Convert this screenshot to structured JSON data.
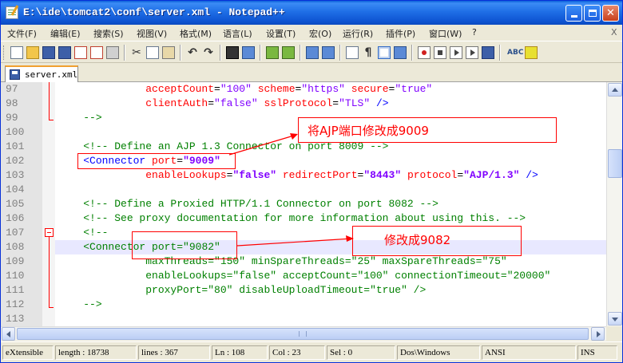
{
  "window": {
    "title": "E:\\ide\\tomcat2\\conf\\server.xml - Notepad++"
  },
  "menu": {
    "items": [
      "文件(F)",
      "编辑(E)",
      "搜索(S)",
      "视图(V)",
      "格式(M)",
      "语言(L)",
      "设置(T)",
      "宏(O)",
      "运行(R)",
      "插件(P)",
      "窗口(W)",
      "?"
    ],
    "close_glyph": "X"
  },
  "toolbar": {
    "icons": [
      "new-file-icon",
      "open-file-icon",
      "save-icon",
      "save-all-icon",
      "close-icon",
      "close-all-icon",
      "print-icon",
      "cut-icon",
      "copy-icon",
      "paste-icon",
      "undo-icon",
      "redo-icon",
      "find-icon",
      "replace-icon",
      "zoom-in-icon",
      "zoom-out-icon",
      "sync-v-icon",
      "sync-h-icon",
      "word-wrap-icon",
      "show-all-chars-icon",
      "indent-guide-icon",
      "user-lang-icon",
      "record-macro-icon",
      "stop-macro-icon",
      "play-macro-icon",
      "run-macro-multiple-icon",
      "save-macro-icon",
      "spell-check-icon",
      "doc-map-icon"
    ]
  },
  "tab": {
    "label": "server.xml"
  },
  "editor": {
    "current_line": "108",
    "lines": [
      {
        "n": "97",
        "indent": "              ",
        "tokens": [
          [
            "attr",
            "acceptCount"
          ],
          [
            "eq",
            "="
          ],
          [
            "val",
            "\"100\""
          ],
          [
            "eq",
            " "
          ],
          [
            "attr",
            "scheme"
          ],
          [
            "eq",
            "="
          ],
          [
            "val",
            "\"https\""
          ],
          [
            "eq",
            " "
          ],
          [
            "attr",
            "secure"
          ],
          [
            "eq",
            "="
          ],
          [
            "val",
            "\"true\""
          ]
        ]
      },
      {
        "n": "98",
        "indent": "              ",
        "tokens": [
          [
            "attr",
            "clientAuth"
          ],
          [
            "eq",
            "="
          ],
          [
            "val",
            "\"false\""
          ],
          [
            "eq",
            " "
          ],
          [
            "attr",
            "sslProtocol"
          ],
          [
            "eq",
            "="
          ],
          [
            "val",
            "\"TLS\""
          ],
          [
            "eq",
            " "
          ],
          [
            "tag",
            "/>"
          ]
        ]
      },
      {
        "n": "99",
        "indent": "    ",
        "tokens": [
          [
            "cmt",
            "-->"
          ]
        ]
      },
      {
        "n": "100",
        "indent": "",
        "tokens": []
      },
      {
        "n": "101",
        "indent": "    ",
        "tokens": [
          [
            "cmt",
            "<!-- Define an AJP 1.3 Connector on port 8009 -->"
          ]
        ]
      },
      {
        "n": "102",
        "indent": "    ",
        "tokens": [
          [
            "tag",
            "<Connector"
          ],
          [
            "eq",
            " "
          ],
          [
            "attr",
            "port"
          ],
          [
            "eq",
            "="
          ],
          [
            "valb",
            "\"9009\""
          ]
        ]
      },
      {
        "n": "103",
        "indent": "              ",
        "tokens": [
          [
            "attr",
            "enableLookups"
          ],
          [
            "eq",
            "="
          ],
          [
            "valb",
            "\"false\""
          ],
          [
            "eq",
            " "
          ],
          [
            "attr",
            "redirectPort"
          ],
          [
            "eq",
            "="
          ],
          [
            "valb",
            "\"8443\""
          ],
          [
            "eq",
            " "
          ],
          [
            "attr",
            "protocol"
          ],
          [
            "eq",
            "="
          ],
          [
            "valb",
            "\"AJP/1.3\""
          ],
          [
            "eq",
            " "
          ],
          [
            "tag",
            "/>"
          ]
        ]
      },
      {
        "n": "104",
        "indent": "",
        "tokens": []
      },
      {
        "n": "105",
        "indent": "    ",
        "tokens": [
          [
            "cmt",
            "<!-- Define a Proxied HTTP/1.1 Connector on port 8082 -->"
          ]
        ]
      },
      {
        "n": "106",
        "indent": "    ",
        "tokens": [
          [
            "cmt",
            "<!-- See proxy documentation for more information about using this. -->"
          ]
        ]
      },
      {
        "n": "107",
        "indent": "    ",
        "tokens": [
          [
            "cmt",
            "<!--"
          ]
        ]
      },
      {
        "n": "108",
        "indent": "    ",
        "tokens": [
          [
            "cmt",
            "<Connector port=\"9082\""
          ]
        ]
      },
      {
        "n": "109",
        "indent": "              ",
        "tokens": [
          [
            "cmt",
            "maxThreads=\"150\" minSpareThreads=\"25\" maxSpareThreads=\"75\""
          ]
        ]
      },
      {
        "n": "110",
        "indent": "              ",
        "tokens": [
          [
            "cmt",
            "enableLookups=\"false\" acceptCount=\"100\" connectionTimeout=\"20000\""
          ]
        ]
      },
      {
        "n": "111",
        "indent": "              ",
        "tokens": [
          [
            "cmt",
            "proxyPort=\"80\" disableUploadTimeout=\"true\" />"
          ]
        ]
      },
      {
        "n": "112",
        "indent": "    ",
        "tokens": [
          [
            "cmt",
            "-->"
          ]
        ]
      },
      {
        "n": "113",
        "indent": "",
        "tokens": []
      }
    ]
  },
  "annotations": {
    "ajp_note": "将AJP端口修改成9009",
    "proxy_note": "修改成9082",
    "color": "#ff0000"
  },
  "status": {
    "file_type": "eXtensible",
    "length": "length : 18738",
    "lines": "lines : 367",
    "ln": "Ln : 108",
    "col": "Col : 23",
    "sel": "Sel : 0",
    "eol": "Dos\\Windows",
    "encoding": "ANSI",
    "mode": "INS"
  },
  "colors": {
    "titlebar": "#1f6fe6",
    "comment": "#008000",
    "tag": "#0000ff",
    "attribute": "#ff0000",
    "value": "#8000ff"
  }
}
